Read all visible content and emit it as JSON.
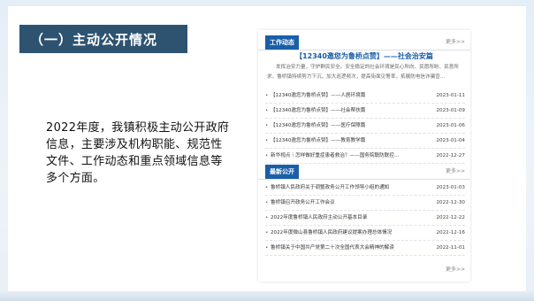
{
  "title": "（一）主动公开情况",
  "body": "2022年度，我镇积极主动公开政府信息，主要涉及机构职能、规范性文件、工作动态和重点领域信息等多个方面。",
  "panel": {
    "work": {
      "tag": "工作动态",
      "more": "更多>>",
      "headline": "【12340邀您为鲁桥点赞】——社会治安篇",
      "summary": "发挥治安力量，守护群民安全。安全稳定的社会环境是民心所向、民愿所盼、民意所求，鲁桥镇持续努力下沉，加大巡逻频次，提高街面见警率，拓展防电信诈骗宣...",
      "items": [
        {
          "text": "【12340邀您为鲁桥点赞】——人居环境篇",
          "date": "2023-01-11"
        },
        {
          "text": "【12340邀您为鲁桥点赞】——社会帮扶篇",
          "date": "2023-01-09"
        },
        {
          "text": "【12340邀您为鲁桥点赞】——医疗保障篇",
          "date": "2023-01-06"
        },
        {
          "text": "【12340邀您为鲁桥点赞】——教育教学篇",
          "date": "2023-01-04"
        },
        {
          "text": "新华视点｜怎样做好重症患者救治？——国务院联防联控...",
          "date": "2022-12-27"
        }
      ]
    },
    "latest": {
      "tag": "最新公开",
      "more": "更多>>",
      "items": [
        {
          "text": "鲁桥镇人民政府关于调整政务公开工作领导小组的通知",
          "date": "2023-01-03"
        },
        {
          "text": "鲁桥镇召开政务公开工作会议",
          "date": "2022-12-30"
        },
        {
          "text": "2022年度鲁桥镇人民政府主动公开基本目录",
          "date": "2022-12-22"
        },
        {
          "text": "2022年度微山县鲁桥镇人民政府建议提案办理总体情况",
          "date": "2022-12-16"
        },
        {
          "text": "鲁桥镇关于中国共产党第二十次全国代表大会精神的解读",
          "date": "2022-11-01"
        }
      ],
      "footer_more": "更多>>"
    }
  },
  "colors": {
    "banner": "#2d5371",
    "accent": "#1a5ea8"
  }
}
